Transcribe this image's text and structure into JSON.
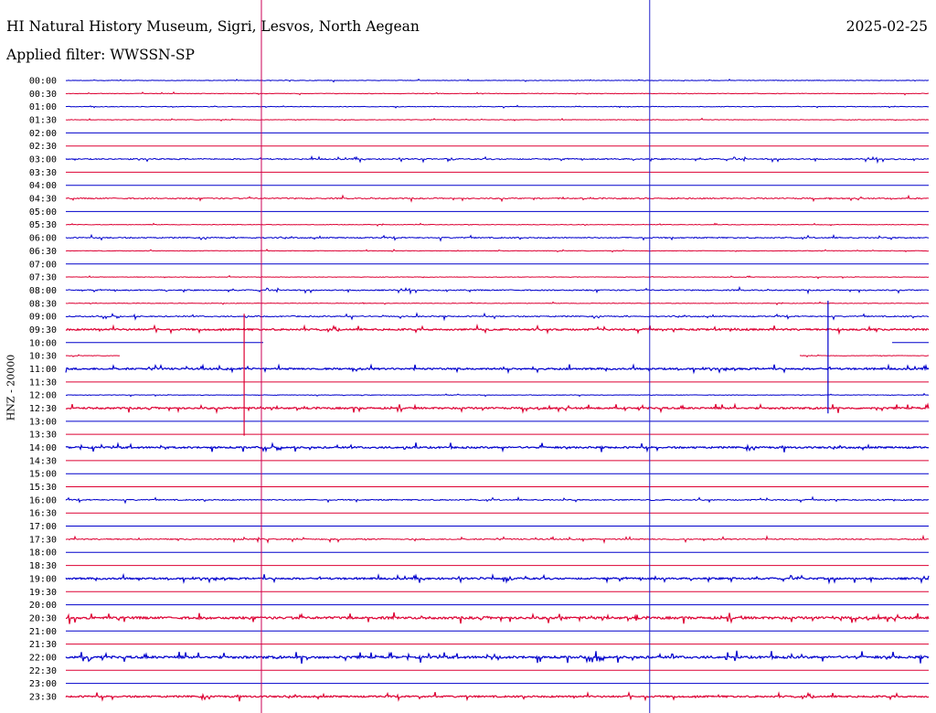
{
  "header": {
    "title": "HI Natural History Museum, Sigri, Lesvos, North Aegean",
    "filter": "Applied filter: WWSSN-SP",
    "date": "2025-02-25"
  },
  "colors": {
    "trace_a": "#0000cc",
    "trace_b": "#dd0033",
    "marker_a": "#cc0055",
    "marker_b": "#2222cc"
  },
  "chart_data": {
    "type": "line",
    "ylabel": "HNZ - 20000",
    "times": [
      "00:00",
      "00:30",
      "01:00",
      "01:30",
      "02:00",
      "02:30",
      "03:00",
      "03:30",
      "04:00",
      "04:30",
      "05:00",
      "05:30",
      "06:00",
      "06:30",
      "07:00",
      "07:30",
      "08:00",
      "08:30",
      "09:00",
      "09:30",
      "10:00",
      "10:30",
      "11:00",
      "11:30",
      "12:00",
      "12:30",
      "13:00",
      "13:30",
      "14:00",
      "14:30",
      "15:00",
      "15:30",
      "16:00",
      "16:30",
      "17:00",
      "17:30",
      "18:00",
      "18:30",
      "19:00",
      "19:30",
      "20:00",
      "20:30",
      "21:00",
      "21:30",
      "22:00",
      "22:30",
      "23:00",
      "23:30"
    ],
    "line_minutes": 30,
    "trace_noise": [
      1,
      1,
      1,
      1,
      0,
      0,
      2,
      0,
      0,
      2,
      0,
      1,
      2,
      1,
      0,
      1,
      2,
      1,
      2,
      3,
      0,
      1,
      3,
      0,
      1,
      3,
      0,
      0,
      3,
      0,
      0,
      0,
      2,
      0,
      0,
      2,
      0,
      0,
      3,
      0,
      0,
      4,
      0,
      0,
      4,
      0,
      0,
      3
    ],
    "gaps": [
      {
        "line": "10:00",
        "from_minute": 6.9,
        "to_minute": 28.5
      },
      {
        "line": "10:30",
        "from_minute": 1.9,
        "to_minute": 25.5
      }
    ],
    "events": [
      {
        "line": "09:30",
        "minute": 6.2,
        "up": 1.2,
        "down": 8.1
      },
      {
        "line": "09:00",
        "minute": 26.5,
        "up": 1.2,
        "down": 7.4
      }
    ],
    "time_markers_minutes": [
      6.8,
      20.3
    ]
  }
}
